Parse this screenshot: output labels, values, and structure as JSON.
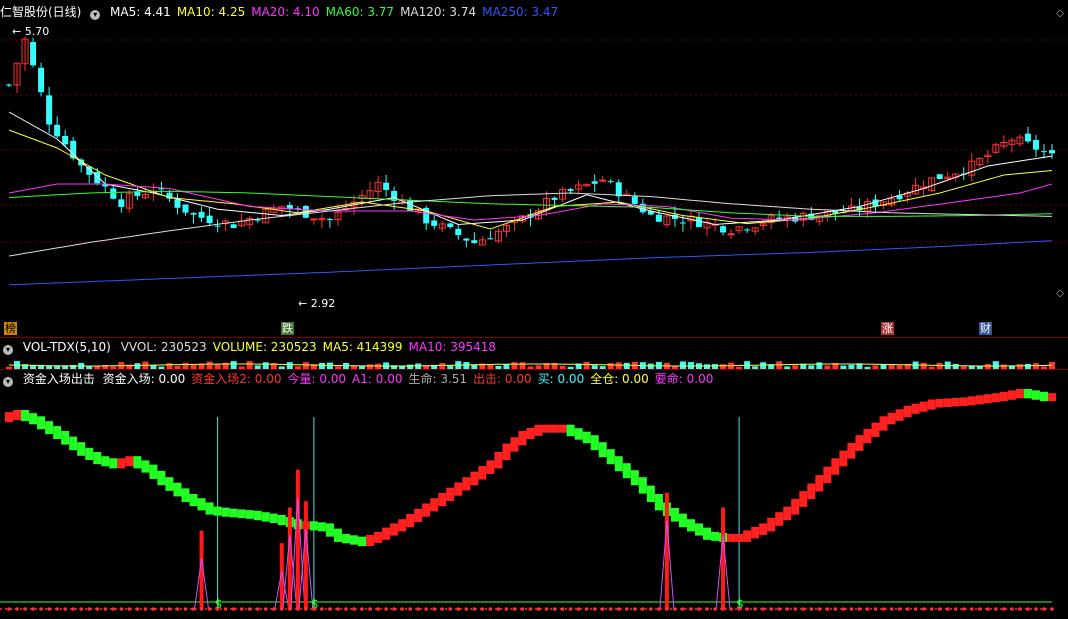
{
  "header": {
    "stock_name": "仁智股份(日线)",
    "ma_items": [
      {
        "label": "MA5: 4.41",
        "color": "#ffffff"
      },
      {
        "label": "MA10: 4.25",
        "color": "#ffff33"
      },
      {
        "label": "MA20: 4.10",
        "color": "#ff33ff"
      },
      {
        "label": "MA60: 3.77",
        "color": "#33ff33"
      },
      {
        "label": "MA120: 3.74",
        "color": "#dddddd"
      },
      {
        "label": "MA250: 3.47",
        "color": "#3355ff"
      }
    ]
  },
  "annotations": {
    "high": "5.70",
    "low": "2.92"
  },
  "event_tags": [
    {
      "text": "榜",
      "bg": "#cc8800",
      "color": "#000000"
    },
    {
      "text": "跌",
      "bg": "#447733",
      "color": "#ffffff"
    },
    {
      "text": "涨",
      "bg": "#aa3333",
      "color": "#ffffff"
    },
    {
      "text": "财",
      "bg": "#335599",
      "color": "#ffffff"
    }
  ],
  "volume_header": {
    "title": "VOL-TDX(5,10)",
    "items": [
      {
        "label": "VVOL: 230523",
        "color": "#dddddd"
      },
      {
        "label": "VOLUME: 230523",
        "color": "#ffff33"
      },
      {
        "label": "MA5: 414399",
        "color": "#ffff33"
      },
      {
        "label": "MA10: 395418",
        "color": "#ff33ff"
      }
    ]
  },
  "indicator_header": {
    "title": "资金入场出击",
    "items": [
      {
        "label": "资金入场: 0.00",
        "color": "#ffffff"
      },
      {
        "label": "资金入场2: 0.00",
        "color": "#ff3333"
      },
      {
        "label": "今量: 0.00",
        "color": "#ff33ff"
      },
      {
        "label": "A1: 0.00",
        "color": "#ff33ff"
      },
      {
        "label": "生命: 3.51",
        "color": "#aaaaaa"
      },
      {
        "label": "出击: 0.00",
        "color": "#ff3333"
      },
      {
        "label": "买: 0.00",
        "color": "#33ffff"
      },
      {
        "label": "全仓: 0.00",
        "color": "#ffff33"
      },
      {
        "label": "要命: 0.00",
        "color": "#ff33ff"
      }
    ]
  },
  "chart_data": [
    {
      "type": "candlestick",
      "title": "仁智股份(日线)",
      "ylim": [
        2.7,
        5.9
      ],
      "n_bars": 131,
      "close_path": [
        [
          0,
          5.2
        ],
        [
          2,
          5.7
        ],
        [
          5,
          4.8
        ],
        [
          9,
          4.3
        ],
        [
          14,
          3.9
        ],
        [
          18,
          4.05
        ],
        [
          23,
          3.75
        ],
        [
          28,
          3.65
        ],
        [
          34,
          3.85
        ],
        [
          40,
          3.7
        ],
        [
          46,
          4.1
        ],
        [
          52,
          3.7
        ],
        [
          58,
          3.45
        ],
        [
          63,
          3.65
        ],
        [
          68,
          3.95
        ],
        [
          74,
          4.15
        ],
        [
          80,
          3.75
        ],
        [
          85,
          3.7
        ],
        [
          90,
          3.6
        ],
        [
          95,
          3.7
        ],
        [
          100,
          3.75
        ],
        [
          105,
          3.8
        ],
        [
          110,
          3.95
        ],
        [
          115,
          4.15
        ],
        [
          120,
          4.3
        ],
        [
          125,
          4.6
        ],
        [
          128,
          4.5
        ],
        [
          130,
          4.4
        ]
      ],
      "ma_paths": {
        "MA5": [
          [
            0,
            4.9
          ],
          [
            6,
            4.6
          ],
          [
            12,
            4.1
          ],
          [
            18,
            4.0
          ],
          [
            26,
            3.82
          ],
          [
            34,
            3.75
          ],
          [
            40,
            3.82
          ],
          [
            48,
            3.95
          ],
          [
            56,
            3.65
          ],
          [
            64,
            3.7
          ],
          [
            72,
            3.98
          ],
          [
            80,
            3.8
          ],
          [
            88,
            3.65
          ],
          [
            96,
            3.7
          ],
          [
            106,
            3.85
          ],
          [
            114,
            4.05
          ],
          [
            122,
            4.3
          ],
          [
            130,
            4.41
          ]
        ],
        "MA10": [
          [
            0,
            4.7
          ],
          [
            6,
            4.5
          ],
          [
            12,
            4.2
          ],
          [
            20,
            3.95
          ],
          [
            28,
            3.88
          ],
          [
            36,
            3.78
          ],
          [
            44,
            3.9
          ],
          [
            52,
            3.8
          ],
          [
            60,
            3.6
          ],
          [
            68,
            3.85
          ],
          [
            76,
            3.9
          ],
          [
            84,
            3.75
          ],
          [
            92,
            3.66
          ],
          [
            100,
            3.72
          ],
          [
            108,
            3.85
          ],
          [
            116,
            4.0
          ],
          [
            124,
            4.2
          ],
          [
            130,
            4.25
          ]
        ],
        "MA20": [
          [
            0,
            4.0
          ],
          [
            6,
            4.1
          ],
          [
            12,
            4.1
          ],
          [
            20,
            4.05
          ],
          [
            30,
            3.85
          ],
          [
            40,
            3.8
          ],
          [
            50,
            3.8
          ],
          [
            58,
            3.7
          ],
          [
            66,
            3.75
          ],
          [
            74,
            3.88
          ],
          [
            82,
            3.85
          ],
          [
            90,
            3.72
          ],
          [
            98,
            3.7
          ],
          [
            108,
            3.78
          ],
          [
            118,
            3.9
          ],
          [
            126,
            4.0
          ],
          [
            130,
            4.1
          ]
        ],
        "MA60": [
          [
            0,
            3.95
          ],
          [
            10,
            4.0
          ],
          [
            20,
            4.02
          ],
          [
            30,
            4.0
          ],
          [
            40,
            3.96
          ],
          [
            50,
            3.92
          ],
          [
            60,
            3.88
          ],
          [
            70,
            3.86
          ],
          [
            80,
            3.84
          ],
          [
            90,
            3.78
          ],
          [
            100,
            3.74
          ],
          [
            110,
            3.74
          ],
          [
            120,
            3.75
          ],
          [
            130,
            3.77
          ]
        ],
        "MA120": [
          [
            0,
            3.3
          ],
          [
            10,
            3.45
          ],
          [
            20,
            3.58
          ],
          [
            30,
            3.7
          ],
          [
            40,
            3.8
          ],
          [
            50,
            3.9
          ],
          [
            60,
            3.97
          ],
          [
            70,
            4.0
          ],
          [
            80,
            3.96
          ],
          [
            90,
            3.88
          ],
          [
            100,
            3.82
          ],
          [
            110,
            3.78
          ],
          [
            120,
            3.76
          ],
          [
            130,
            3.74
          ]
        ],
        "MA250": [
          [
            0,
            2.98
          ],
          [
            20,
            3.05
          ],
          [
            40,
            3.12
          ],
          [
            60,
            3.2
          ],
          [
            80,
            3.28
          ],
          [
            100,
            3.34
          ],
          [
            115,
            3.4
          ],
          [
            130,
            3.47
          ]
        ]
      }
    },
    {
      "type": "bar",
      "title": "VOL-TDX(5,10)",
      "series": [
        {
          "name": "VOLUME",
          "values_hint": "latest 230523"
        },
        {
          "name": "MA5",
          "values_hint": "414399"
        },
        {
          "name": "MA10",
          "values_hint": "395418"
        }
      ]
    },
    {
      "type": "line",
      "title": "资金入场出击",
      "ylim": [
        0,
        1
      ],
      "main_line": [
        [
          0,
          0.88
        ],
        [
          2,
          0.9
        ],
        [
          4,
          0.87
        ],
        [
          7,
          0.8
        ],
        [
          10,
          0.72
        ],
        [
          12,
          0.68
        ],
        [
          14,
          0.66
        ],
        [
          16,
          0.68
        ],
        [
          18,
          0.64
        ],
        [
          20,
          0.58
        ],
        [
          23,
          0.5
        ],
        [
          26,
          0.44
        ],
        [
          28,
          0.43
        ],
        [
          31,
          0.42
        ],
        [
          34,
          0.4
        ],
        [
          37,
          0.37
        ],
        [
          38,
          0.37
        ],
        [
          40,
          0.36
        ],
        [
          42,
          0.31
        ],
        [
          45,
          0.29
        ],
        [
          47,
          0.32
        ],
        [
          50,
          0.38
        ],
        [
          54,
          0.48
        ],
        [
          58,
          0.58
        ],
        [
          61,
          0.66
        ],
        [
          63,
          0.74
        ],
        [
          65,
          0.8
        ],
        [
          67,
          0.83
        ],
        [
          70,
          0.83
        ],
        [
          73,
          0.78
        ],
        [
          76,
          0.68
        ],
        [
          79,
          0.58
        ],
        [
          82,
          0.46
        ],
        [
          85,
          0.38
        ],
        [
          88,
          0.32
        ],
        [
          90,
          0.31
        ],
        [
          92,
          0.31
        ],
        [
          95,
          0.36
        ],
        [
          98,
          0.44
        ],
        [
          101,
          0.55
        ],
        [
          104,
          0.67
        ],
        [
          107,
          0.78
        ],
        [
          110,
          0.87
        ],
        [
          113,
          0.92
        ],
        [
          116,
          0.95
        ],
        [
          120,
          0.96
        ],
        [
          124,
          0.98
        ],
        [
          127,
          1.0
        ],
        [
          130,
          0.98
        ]
      ],
      "spikes": [
        [
          24,
          0.34
        ],
        [
          34,
          0.28
        ],
        [
          35,
          0.45
        ],
        [
          36,
          0.63
        ],
        [
          37,
          0.48
        ],
        [
          82,
          0.52
        ],
        [
          89,
          0.45
        ]
      ],
      "signal_lines": [
        26,
        38,
        91
      ],
      "buy_marks": [
        26,
        38,
        91
      ]
    }
  ]
}
